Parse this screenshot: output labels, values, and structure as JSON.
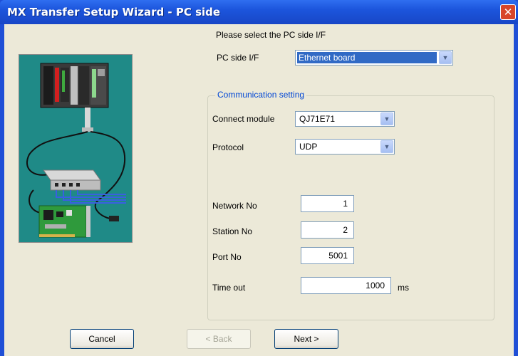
{
  "window": {
    "title": "MX Transfer Setup Wizard - PC side"
  },
  "intro": {
    "prompt": "Please select the PC side I/F"
  },
  "pc_side": {
    "label": "PC side I/F",
    "value": "Ethernet board"
  },
  "communication": {
    "group_title": "Communication setting",
    "connect_module": {
      "label": "Connect module",
      "value": "QJ71E71"
    },
    "protocol": {
      "label": "Protocol",
      "value": "UDP"
    },
    "network_no": {
      "label": "Network No",
      "value": "1"
    },
    "station_no": {
      "label": "Station No",
      "value": "2"
    },
    "port_no": {
      "label": "Port No",
      "value": "5001"
    },
    "time_out": {
      "label": "Time out",
      "value": "1000",
      "unit": "ms"
    }
  },
  "buttons": {
    "cancel": "Cancel",
    "back": "< Back",
    "next": "Next >"
  },
  "colors": {
    "titlebar": "#1c55dc",
    "dialog_bg": "#ece9d8",
    "illustration_bg": "#1f8a87",
    "group_title": "#0046d5"
  }
}
